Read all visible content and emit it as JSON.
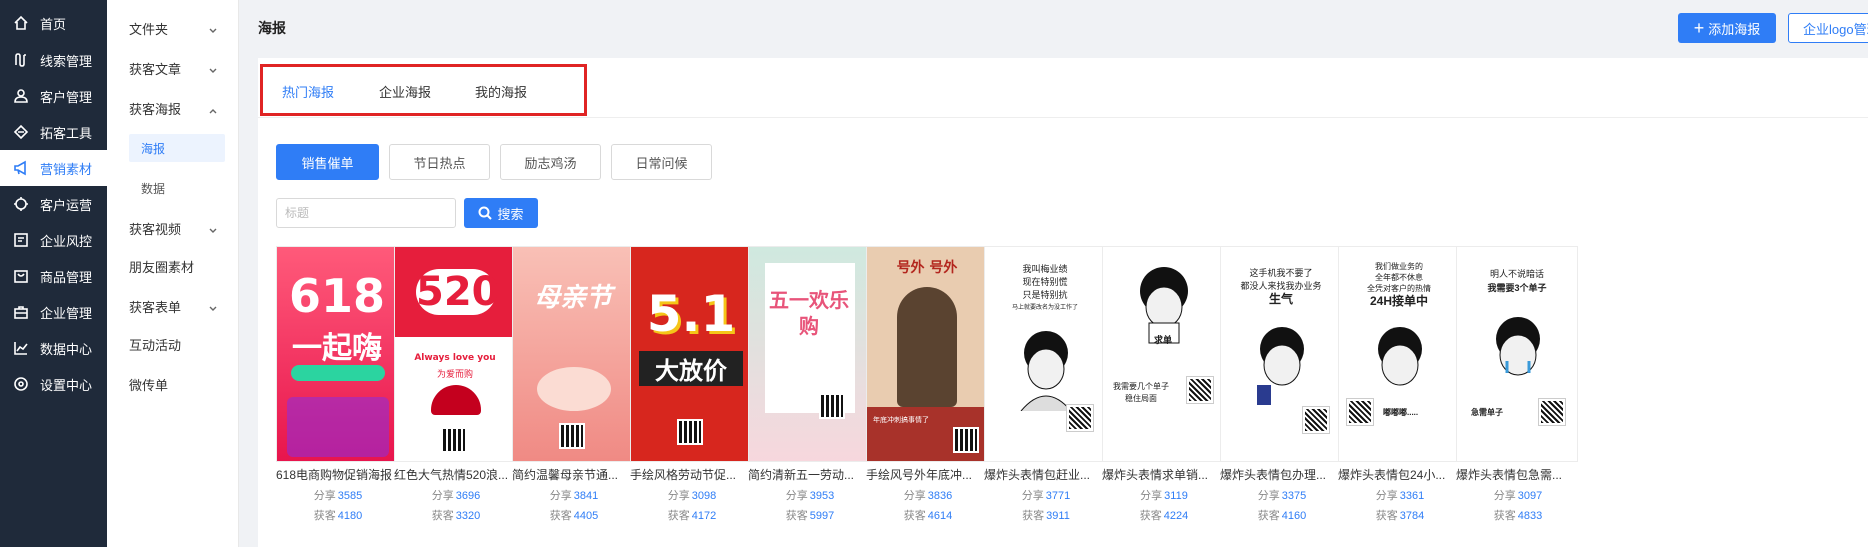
{
  "sidebar": {
    "items": [
      {
        "label": "首页",
        "icon": "home-icon"
      },
      {
        "label": "线索管理",
        "icon": "clue-icon"
      },
      {
        "label": "客户管理",
        "icon": "customer-icon"
      },
      {
        "label": "拓客工具",
        "icon": "tool-icon"
      },
      {
        "label": "营销素材",
        "icon": "megaphone-icon",
        "active": true
      },
      {
        "label": "客户运营",
        "icon": "operation-icon"
      },
      {
        "label": "企业风控",
        "icon": "risk-icon"
      },
      {
        "label": "商品管理",
        "icon": "product-icon"
      },
      {
        "label": "企业管理",
        "icon": "company-icon"
      },
      {
        "label": "数据中心",
        "icon": "chart-icon"
      },
      {
        "label": "设置中心",
        "icon": "settings-icon"
      }
    ]
  },
  "subnav": {
    "folder": "文件夹",
    "article": "获客文章",
    "poster_group": "获客海报",
    "poster_child": "海报",
    "data_child": "数据",
    "video": "获客视频",
    "moments": "朋友圈素材",
    "form": "获客表单",
    "interactive": "互动活动",
    "microflyer": "微传单"
  },
  "header": {
    "title": "海报",
    "add_button": "添加海报",
    "logo_button": "企业logo管理"
  },
  "tabs": {
    "hot": "热门海报",
    "company": "企业海报",
    "mine": "我的海报"
  },
  "categories": [
    "销售催单",
    "节日热点",
    "励志鸡汤",
    "日常问候"
  ],
  "search": {
    "placeholder": "标题",
    "button": "搜索"
  },
  "stat_labels": {
    "share": "分享",
    "gain": "获客"
  },
  "posters": [
    {
      "title": "618电商购物促销海报",
      "share": "3585",
      "gain": "4180",
      "main_text": "618",
      "sub_text": "一起嗨"
    },
    {
      "title": "红色大气热情520浪...",
      "share": "3696",
      "gain": "3320",
      "main_text": "520",
      "sub_text": "Always love you",
      "sub_text2": "为爱而购"
    },
    {
      "title": "简约温馨母亲节通...",
      "share": "3841",
      "gain": "4405",
      "main_text": "母亲节"
    },
    {
      "title": "手绘风格劳动节促...",
      "share": "3098",
      "gain": "4172",
      "main_text": "5.1",
      "sub_text": "大放价"
    },
    {
      "title": "简约清新五一劳动...",
      "share": "3953",
      "gain": "5997",
      "main_text": "五一欢乐购"
    },
    {
      "title": "手绘风号外年底冲...",
      "share": "3836",
      "gain": "4614",
      "main_text": "号外 号外",
      "sub_text": "年底冲刺搞事情了"
    },
    {
      "title": "爆炸头表情包赶业...",
      "share": "3771",
      "gain": "3911",
      "lines": [
        "我叫梅业绩",
        "现在特别慌",
        "只是特别抗",
        "马上就要改名为没工作了"
      ]
    },
    {
      "title": "爆炸头表情求单销...",
      "share": "3119",
      "gain": "4224",
      "lines": [
        "求单",
        "我需要几个单子",
        "稳住局面"
      ]
    },
    {
      "title": "爆炸头表情包办理...",
      "share": "3375",
      "gain": "4160",
      "lines": [
        "这手机我不要了",
        "都没人来找我办业务",
        "生气"
      ]
    },
    {
      "title": "爆炸头表情包24小...",
      "share": "3361",
      "gain": "3784",
      "lines": [
        "我们做业务的",
        "全年都不休息",
        "全凭对客户的热情",
        "24H接单中",
        "嘟嘟嘟....."
      ]
    },
    {
      "title": "爆炸头表情包急需...",
      "share": "3097",
      "gain": "4833",
      "lines": [
        "明人不说暗话",
        "我需要3个单子",
        "急需单子"
      ]
    }
  ],
  "colors": {
    "accent": "#2f7df6",
    "sidebar_bg": "#1f2a3a",
    "highlight_border": "#e02424"
  }
}
